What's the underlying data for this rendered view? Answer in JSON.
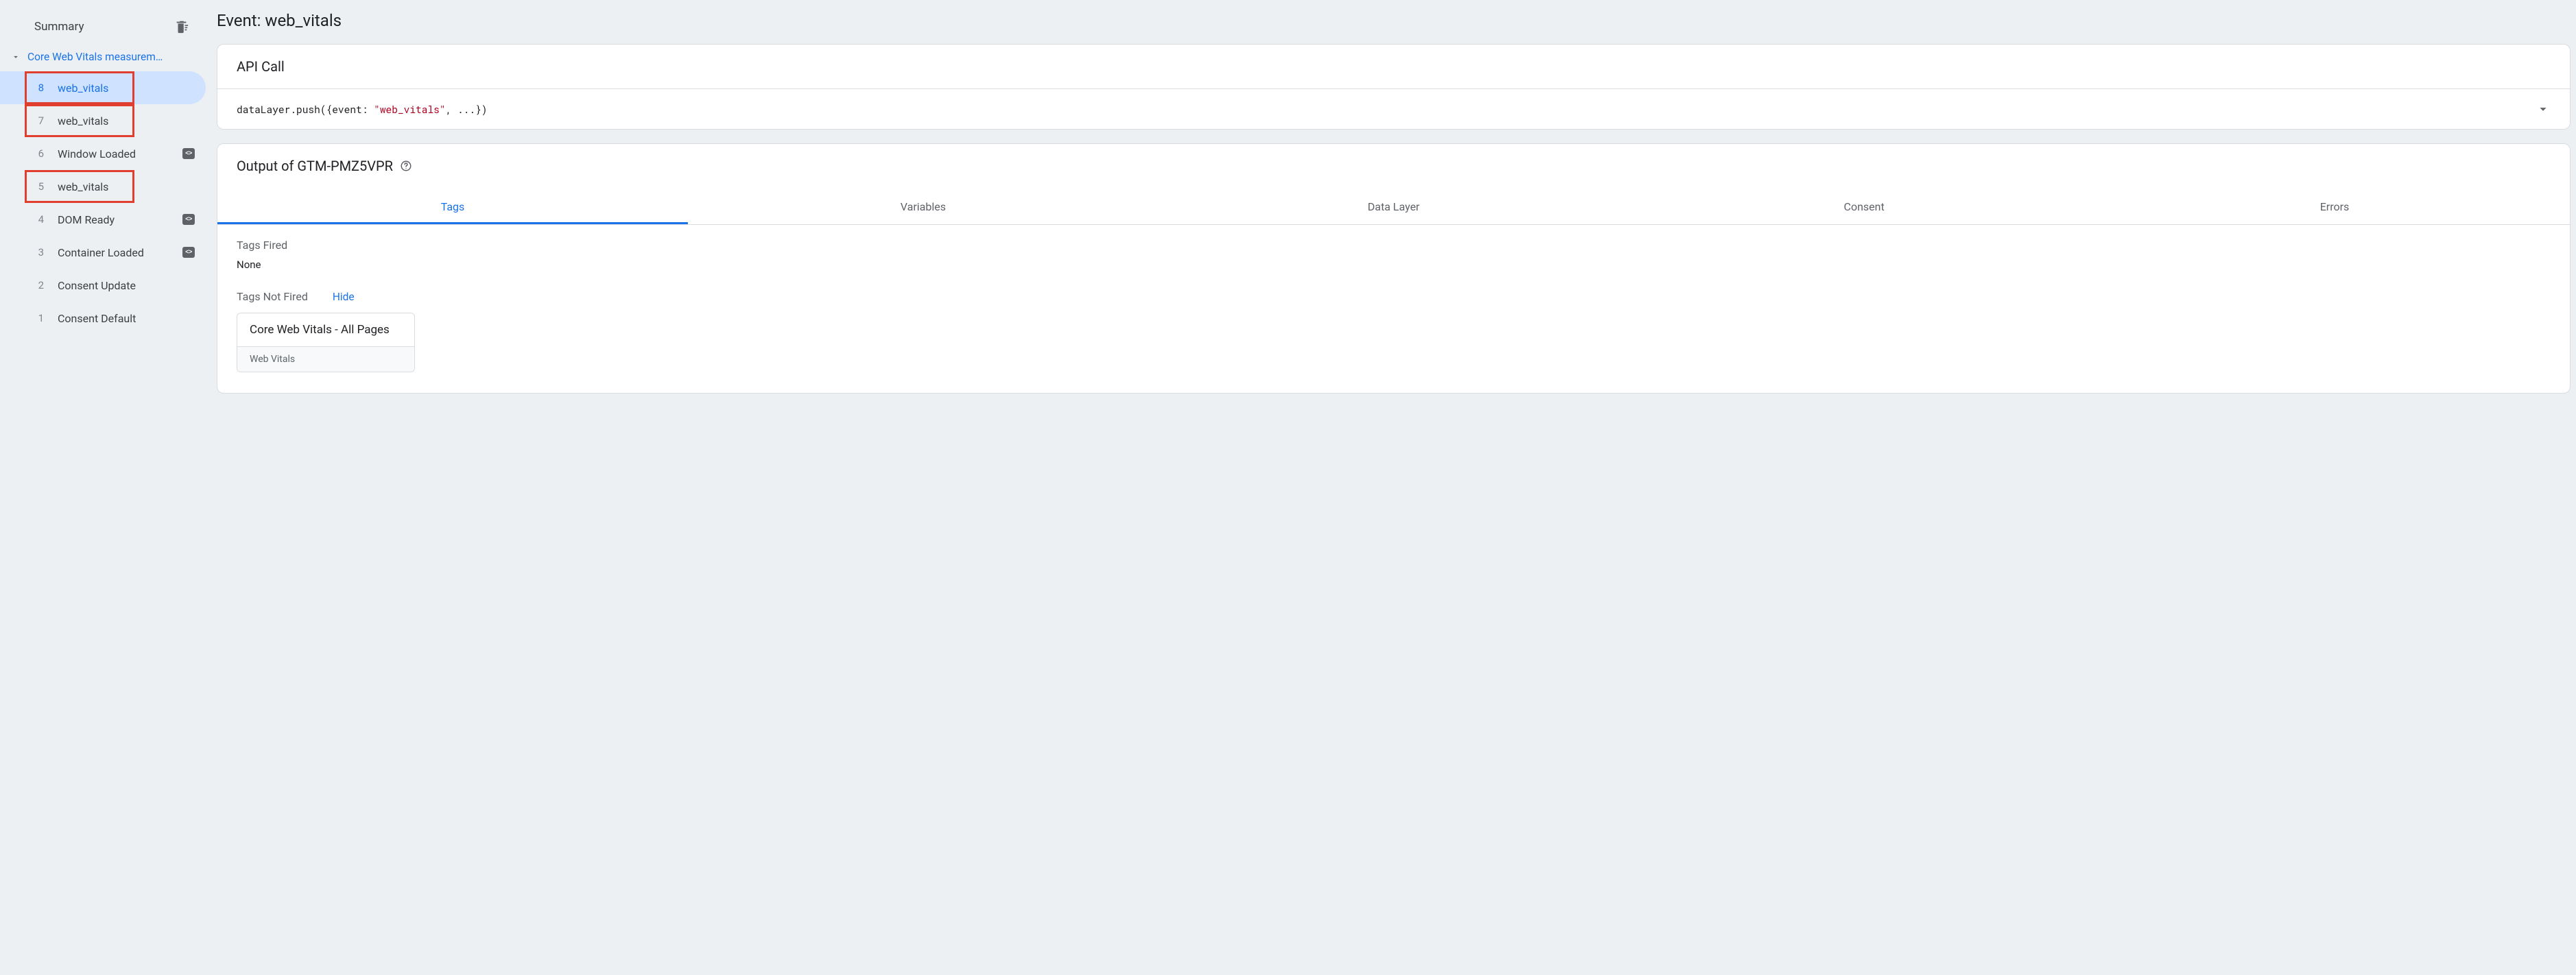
{
  "sidebar": {
    "summary_label": "Summary",
    "clear_icon_name": "clear-summary-icon",
    "group_label": "Core Web Vitals measurem…",
    "events": [
      {
        "num": "8",
        "label": "web_vitals",
        "selected": true,
        "highlight": true,
        "has_code_badge": false
      },
      {
        "num": "7",
        "label": "web_vitals",
        "selected": false,
        "highlight": true,
        "has_code_badge": false
      },
      {
        "num": "6",
        "label": "Window Loaded",
        "selected": false,
        "highlight": false,
        "has_code_badge": true
      },
      {
        "num": "5",
        "label": "web_vitals",
        "selected": false,
        "highlight": true,
        "has_code_badge": false
      },
      {
        "num": "4",
        "label": "DOM Ready",
        "selected": false,
        "highlight": false,
        "has_code_badge": true
      },
      {
        "num": "3",
        "label": "Container Loaded",
        "selected": false,
        "highlight": false,
        "has_code_badge": true
      },
      {
        "num": "2",
        "label": "Consent Update",
        "selected": false,
        "highlight": false,
        "has_code_badge": false
      },
      {
        "num": "1",
        "label": "Consent Default",
        "selected": false,
        "highlight": false,
        "has_code_badge": false
      }
    ]
  },
  "main": {
    "title": "Event: web_vitals",
    "api_call": {
      "header": "API Call",
      "code_prefix": "dataLayer.push({event: ",
      "code_string": "\"web_vitals\"",
      "code_suffix": ", ...})"
    },
    "output": {
      "header_prefix": "Output of ",
      "container_id": "GTM-PMZ5VPR",
      "tabs": [
        "Tags",
        "Variables",
        "Data Layer",
        "Consent",
        "Errors"
      ],
      "active_tab_index": 0,
      "tags_fired_label": "Tags Fired",
      "tags_fired_none": "None",
      "tags_not_fired_label": "Tags Not Fired",
      "hide_label": "Hide",
      "not_fired": [
        {
          "name": "Core Web Vitals - All Pages",
          "type": "Web Vitals"
        }
      ]
    }
  }
}
